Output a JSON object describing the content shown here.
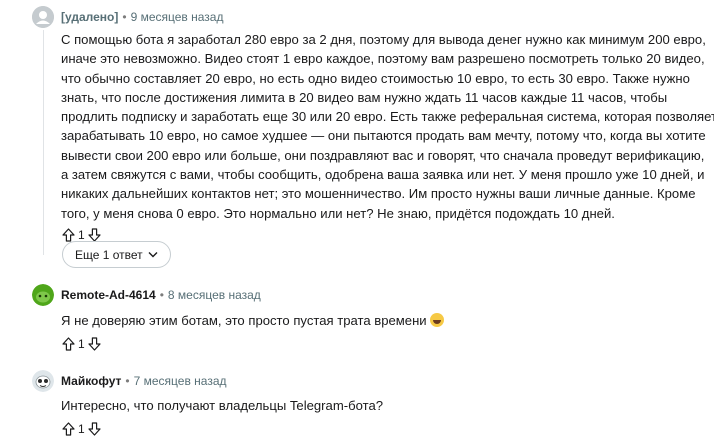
{
  "comments": [
    {
      "author": "[удалено]",
      "time": "9 месяцев назад",
      "lines": [
        "С помощью бота я заработал 280 евро за 2 дня, поэтому для вывода денег нужно как минимум 200 евро,",
        "иначе это невозможно. Видео стоят 1 евро каждое, поэтому вам разрешено посмотреть только 20 видео,",
        "что обычно составляет 20 евро, но есть одно видео стоимостью 10 евро, то есть 30 евро. Также нужно",
        "знать, что после достижения лимита в 20 видео вам нужно ждать 11 часов каждые 11 часов, чтобы",
        "продлить подписку и заработать еще 30 или 20 евро. Есть также реферальная система, которая позволяет",
        "зарабатывать 10 евро, но самое худшее — они пытаются продать вам мечту, потому что, когда вы хотите",
        "вывести свои 200 евро или больше, они поздравляют вас и говорят, что сначала проведут верификацию,",
        "а затем свяжутся с вами, чтобы сообщить, одобрена ваша заявка или нет. У меня прошло уже 10 дней, и",
        "никаких дальнейших контактов нет; это мошенничество. Им просто нужны ваши личные данные. Кроме",
        "того, у меня снова 0 евро. Это нормально или нет? Не знаю, придётся подождать 10 дней."
      ],
      "score": "1",
      "avatar_color": "#b8c0c4"
    },
    {
      "author": "Remote-Ad-4614",
      "time": "8 месяцев назад",
      "lines": [
        "Я не доверяю этим ботам, это просто пустая трата времени"
      ],
      "score": "1",
      "avatar_color": "#46a508"
    },
    {
      "author": "Майкофут",
      "time": "7 месяцев назад",
      "lines": [
        "Интересно, что получают владельцы Telegram-бота?"
      ],
      "score": "1",
      "avatar_color": "#e9eef2"
    }
  ],
  "more_replies_label": "Еще 1 ответ",
  "icons": {
    "upvote": "arrow-up-icon",
    "downvote": "arrow-down-icon",
    "chevron": "chevron-down-icon",
    "emoji": "laughing-emoji"
  }
}
